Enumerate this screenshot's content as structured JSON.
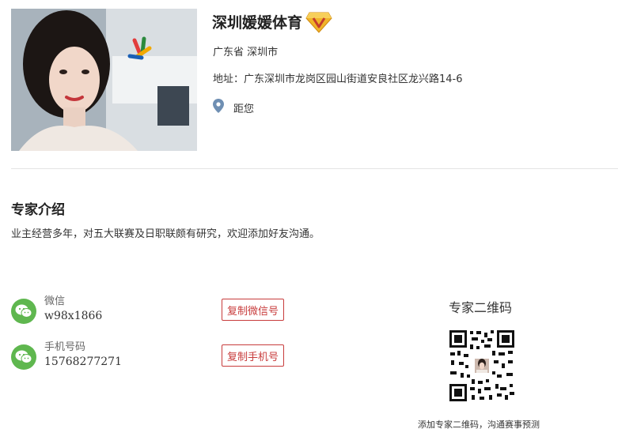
{
  "profile": {
    "name": "深圳媛媛体育",
    "region": "广东省 深圳市",
    "address": "地址：广东深圳市龙岗区园山街道安良社区龙兴路14-6",
    "distance_label": "距您"
  },
  "intro": {
    "title": "专家介绍",
    "text": "业主经营多年，对五大联赛及日职联颇有研究，欢迎添加好友沟通。"
  },
  "contacts": {
    "wechat": {
      "label": "微信",
      "value": "w98x1866",
      "button": "复制微信号"
    },
    "phone": {
      "label": "手机号码",
      "value": "15768277271",
      "button": "复制手机号"
    }
  },
  "qr": {
    "title": "专家二维码",
    "caption": "添加专家二维码，沟通赛事预测"
  },
  "icons": {
    "vip": "vip-diamond-icon",
    "location": "location-pin-icon",
    "wechat": "wechat-icon"
  },
  "colors": {
    "accent_red": "#c83c3c",
    "wechat_green": "#5fb74f",
    "badge_gold": "#f0b429",
    "pin_blue": "#6f8fb3"
  }
}
